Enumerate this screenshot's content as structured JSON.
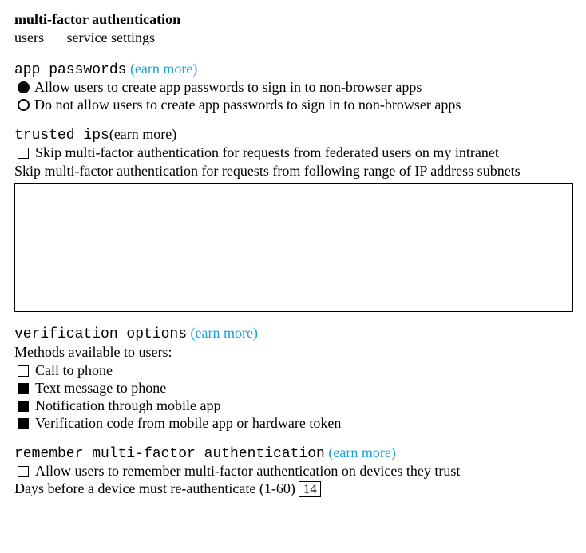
{
  "title": "multi-factor authentication",
  "tabs": {
    "users": "users",
    "service_settings": "service settings"
  },
  "app_passwords": {
    "heading": "app passwords",
    "learn": "(earn more)",
    "allow_label": "Allow users to create app passwords to sign in to non-browser apps",
    "deny_label": "Do not allow users to create app passwords to sign in to non-browser apps",
    "selected": "allow"
  },
  "trusted_ips": {
    "heading": "trusted ips",
    "learn": "(earn more)",
    "skip_federated_label": "Skip multi-factor authentication for requests from federated users on my intranet",
    "skip_federated_checked": false,
    "skip_range_label": "Skip multi-factor authentication for requests from following range of IP address subnets",
    "ip_value": ""
  },
  "verification": {
    "heading": "verification options",
    "learn": "(earn more)",
    "sub": "Methods available to users:",
    "methods": {
      "call": {
        "label": "Call to phone",
        "checked": false
      },
      "text": {
        "label": "Text message to phone",
        "checked": true
      },
      "notify": {
        "label": "Notification through mobile app",
        "checked": true
      },
      "code": {
        "label": "Verification code from mobile app or hardware token",
        "checked": true
      }
    }
  },
  "remember": {
    "heading": "remember multi-factor authentication",
    "learn": "(earn more)",
    "allow_label": "Allow users to remember multi-factor authentication on devices they trust",
    "allow_checked": false,
    "days_label": "Days before a device must re-authenticate (1-60) ",
    "days_value": "14"
  }
}
